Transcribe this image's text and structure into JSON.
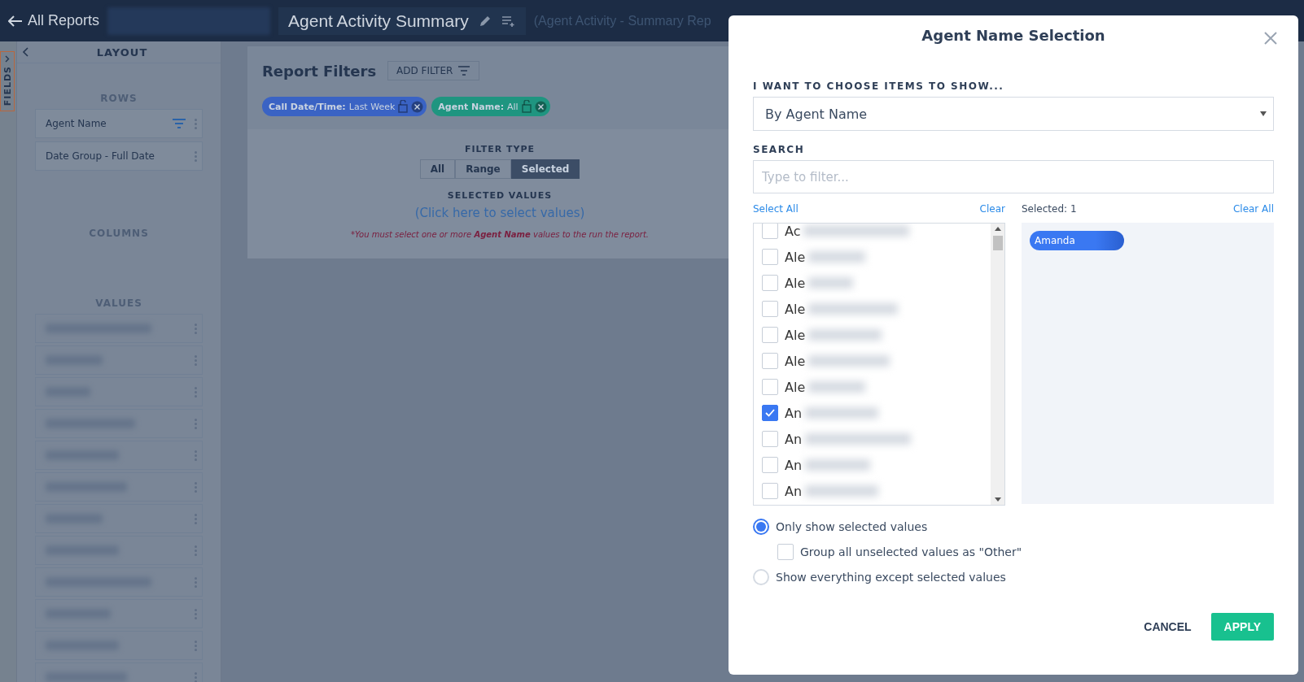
{
  "header": {
    "back_link": "All Reports",
    "title": "Agent Activity Summary",
    "subtitle": "(Agent Activity - Summary Rep"
  },
  "sidebar": {
    "fields_tab": "FIELDS",
    "layout_title": "LAYOUT",
    "rows_title": "ROWS",
    "rows": [
      {
        "label": "Agent Name",
        "filtered": true
      },
      {
        "label": "Date Group - Full Date",
        "filtered": false
      }
    ],
    "columns_title": "COLUMNS",
    "values_title": "VALUES"
  },
  "filters": {
    "title": "Report Filters",
    "add_filter": "ADD FILTER",
    "chips": [
      {
        "name": "Call Date/Time:",
        "value": "Last Week",
        "color": "#3a63c4"
      },
      {
        "name": "Agent Name:",
        "value": "All",
        "color": "#1f9580"
      }
    ],
    "filter_type_label": "FILTER TYPE",
    "filter_types": [
      {
        "label": "All",
        "selected": false
      },
      {
        "label": "Range",
        "selected": false
      },
      {
        "label": "Selected",
        "selected": true
      }
    ],
    "selected_values_label": "SELECTED VALUES",
    "select_link": "(Click here to select values)",
    "note": "*You must select one or more **Agent Name** values to the run the report."
  },
  "modal": {
    "title": "Agent Name Selection",
    "chooser_label": "I WANT TO CHOOSE ITEMS TO SHOW...",
    "chooser_value": "By Agent Name",
    "search_label": "SEARCH",
    "search": {
      "placeholder": "Type to filter..."
    },
    "select_all": "Select All",
    "clear": "Clear",
    "selected_count": "Selected: 1",
    "clear_all": "Clear All",
    "items": [
      {
        "label": "Ac",
        "checked": false
      },
      {
        "label": "Ale",
        "checked": false
      },
      {
        "label": "Ale",
        "checked": false
      },
      {
        "label": "Ale",
        "checked": false
      },
      {
        "label": "Ale",
        "checked": false
      },
      {
        "label": "Ale",
        "checked": false
      },
      {
        "label": "Ale",
        "checked": false
      },
      {
        "label": "An",
        "checked": true
      },
      {
        "label": "An",
        "checked": false
      },
      {
        "label": "An",
        "checked": false
      },
      {
        "label": "An",
        "checked": false
      }
    ],
    "selected_chips": [
      "Amanda"
    ],
    "options": [
      {
        "kind": "radio",
        "label": "Only show selected values",
        "selected": true
      },
      {
        "kind": "checkbox",
        "label": "Group all unselected values as \"Other\"",
        "checked": false
      },
      {
        "kind": "radio",
        "label": "Show everything except selected values",
        "selected": false
      }
    ],
    "cancel": "CANCEL",
    "apply": "APPLY"
  }
}
